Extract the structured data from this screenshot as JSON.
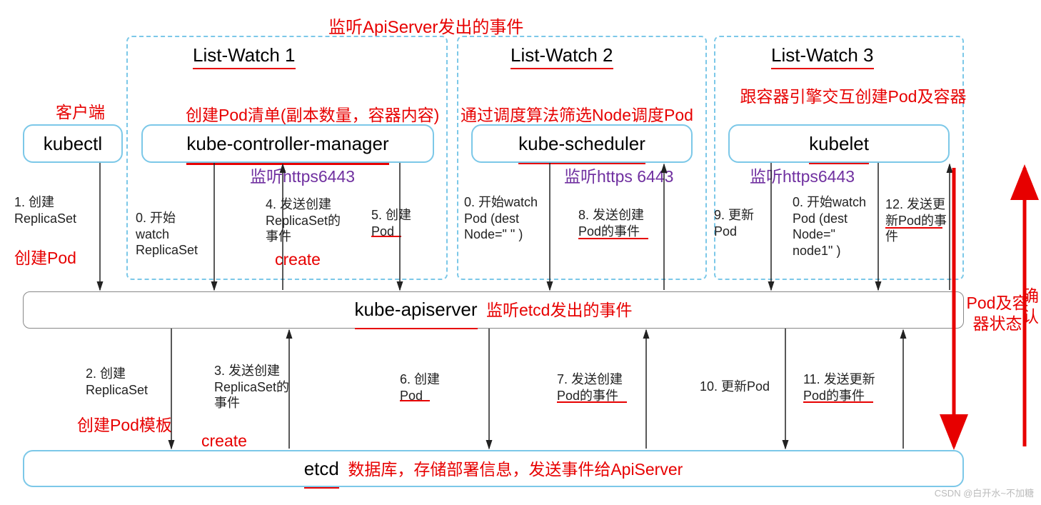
{
  "title_top": "监听ApiServer发出的事件",
  "watchers": {
    "w1": "List-Watch 1",
    "w2": "List-Watch 2",
    "w3": "List-Watch 3"
  },
  "client_label": "客户端",
  "boxes": {
    "kubectl": "kubectl",
    "kcm": "kube-controller-manager",
    "scheduler": "kube-scheduler",
    "kubelet": "kubelet",
    "apiserver": "kube-apiserver",
    "etcd": "etcd"
  },
  "red_desc": {
    "kcm": "创建Pod清单(副本数量，容器内容)",
    "scheduler": "通过调度算法筛选Node调度Pod",
    "kubelet": "跟容器引擎交互创建Pod及容器"
  },
  "purple": {
    "l1": "监听https6443",
    "l2": "监听https 6443",
    "l3": "监听https6443"
  },
  "steps_top": {
    "s1": "1. 创建ReplicaSet",
    "s0a": "0. 开始watch ReplicaSet",
    "s4": "4. 发送创建ReplicaSet的事件",
    "s5": "5. 创建Pod",
    "s0b": "0. 开始watch Pod (dest Node=\" \" )",
    "s8": "8. 发送创建Pod的事件",
    "s9": "9. 更新Pod",
    "s0c": "0. 开始watch Pod (dest Node=\" node1\" )",
    "s12": "12. 发送更新Pod的事件"
  },
  "annot_top": {
    "create1": "创建Pod",
    "create_word1": "create"
  },
  "apiserver_note": "监听etcd发出的事件",
  "steps_bottom": {
    "s2": "2. 创建ReplicaSet",
    "s3": "3. 发送创建ReplicaSet的事件",
    "s6": "6. 创建Pod",
    "s7": "7. 发送创建Pod的事件",
    "s10": "10. 更新Pod",
    "s11": "11. 发送更新Pod的事件"
  },
  "annot_bottom": {
    "tpl": "创建Pod模板",
    "create_word2": "create"
  },
  "etcd_note": "数据库，存储部署信息，发送事件给ApiServer",
  "side": {
    "left_red": "Pod及容器状态",
    "right_red": "确认"
  },
  "watermark": "CSDN @白开水~不加糖"
}
